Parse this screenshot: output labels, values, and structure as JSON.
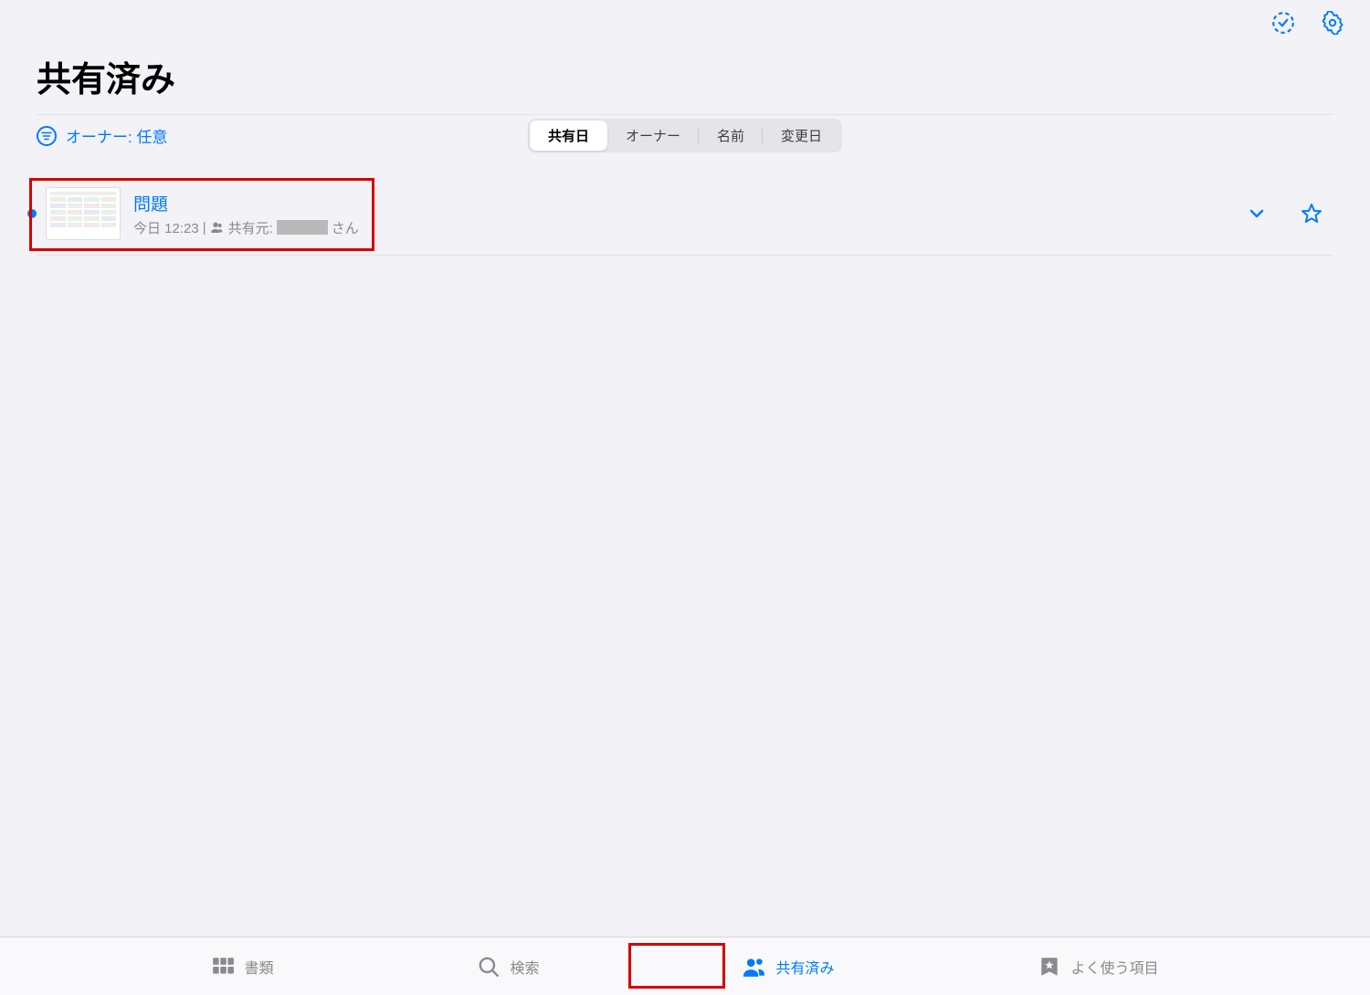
{
  "header": {
    "title": "共有済み"
  },
  "filter": {
    "owner_label": "オーナー: 任意"
  },
  "segments": {
    "share_date": "共有日",
    "owner": "オーナー",
    "name": "名前",
    "modified": "変更日"
  },
  "file": {
    "title": "問題",
    "meta_time": "今日 12:23",
    "meta_sep": " | ",
    "shared_prefix": "共有元:",
    "shared_suffix": "さん"
  },
  "tabs": {
    "documents": "書類",
    "search": "検索",
    "shared": "共有済み",
    "favorites": "よく使う項目"
  }
}
